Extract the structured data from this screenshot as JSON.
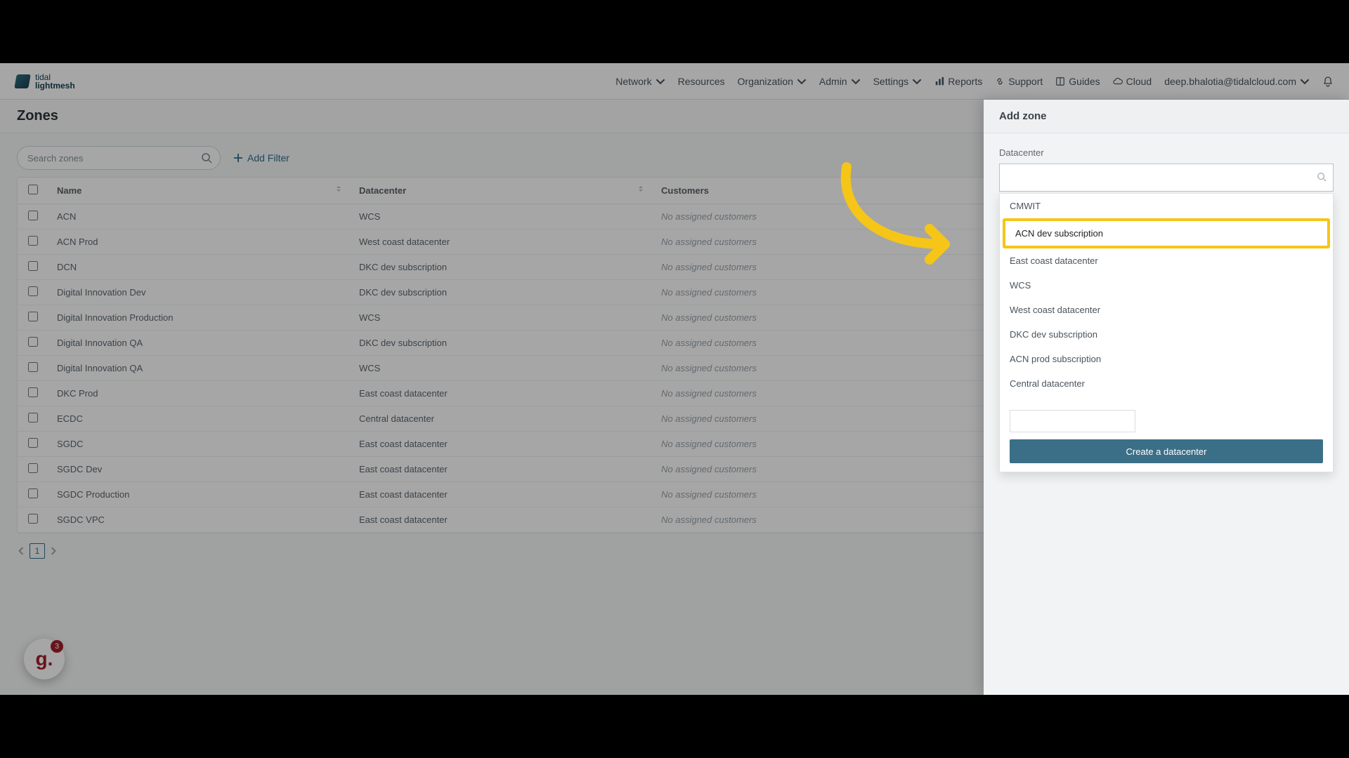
{
  "brand": {
    "line1": "tidal",
    "line2": "lightmesh"
  },
  "nav": {
    "network": "Network",
    "resources": "Resources",
    "organization": "Organization",
    "admin": "Admin",
    "settings": "Settings",
    "reports": "Reports",
    "support": "Support",
    "guides": "Guides",
    "cloud": "Cloud",
    "user_email": "deep.bhalotia@tidalcloud.com"
  },
  "page": {
    "title": "Zones"
  },
  "toolbar": {
    "search_placeholder": "Search zones",
    "add_filter": "Add Filter"
  },
  "table": {
    "columns": {
      "name": "Name",
      "datacenter": "Datacenter",
      "customers": "Customers"
    },
    "no_customers": "No assigned customers",
    "rows": [
      {
        "name": "ACN",
        "dc": "WCS"
      },
      {
        "name": "ACN Prod",
        "dc": "West coast datacenter"
      },
      {
        "name": "DCN",
        "dc": "DKC dev subscription"
      },
      {
        "name": "Digital Innovation Dev",
        "dc": "DKC dev subscription"
      },
      {
        "name": "Digital Innovation Production",
        "dc": "WCS"
      },
      {
        "name": "Digital Innovation QA",
        "dc": "DKC dev subscription"
      },
      {
        "name": "Digital Innovation QA",
        "dc": "WCS"
      },
      {
        "name": "DKC Prod",
        "dc": "East coast datacenter"
      },
      {
        "name": "ECDC",
        "dc": "Central datacenter"
      },
      {
        "name": "SGDC",
        "dc": "East coast datacenter"
      },
      {
        "name": "SGDC Dev",
        "dc": "East coast datacenter"
      },
      {
        "name": "SGDC Production",
        "dc": "East coast datacenter"
      },
      {
        "name": "SGDC VPC",
        "dc": "East coast datacenter"
      }
    ]
  },
  "pagination": {
    "page": "1"
  },
  "float_badge": {
    "glyph": "g.",
    "count": "3"
  },
  "side_panel": {
    "title": "Add zone",
    "datacenter_label": "Datacenter",
    "datacenter_value": "",
    "options": [
      "CMWIT",
      "ACN dev subscription",
      "East coast datacenter",
      "WCS",
      "West coast datacenter",
      "DKC dev subscription",
      "ACN prod subscription",
      "Central datacenter"
    ],
    "highlight_index": 1,
    "create_btn": "Create a datacenter"
  }
}
